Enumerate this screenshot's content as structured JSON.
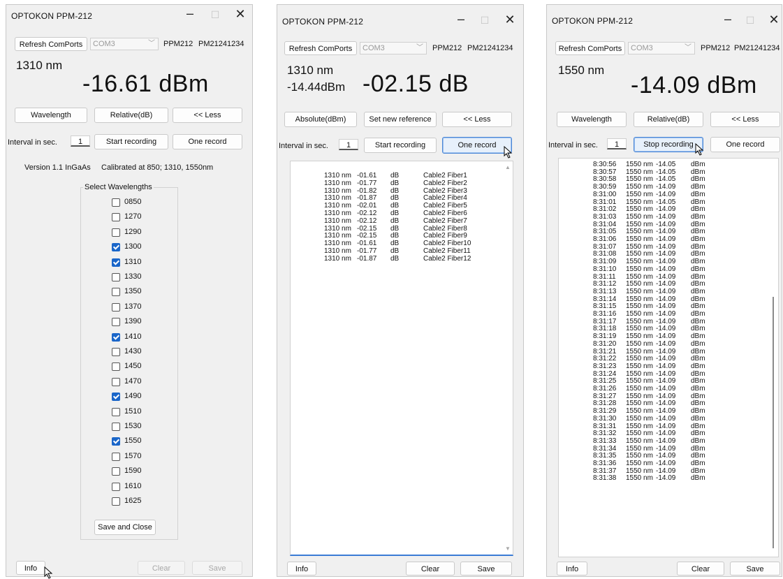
{
  "windows": [
    {
      "title": "OPTOKON  PPM-212",
      "refresh_label": "Refresh ComPorts",
      "com_value": "COM3",
      "device": "PPM212",
      "serial": "PM21241234",
      "wavelength": "1310 nm",
      "reading": "-16.61  dBm",
      "btn_wavelength": "Wavelength",
      "btn_relative": "Relative(dB)",
      "btn_less": "<< Less",
      "interval_label": "Interval in sec.",
      "interval_value": "1",
      "btn_start": "Start recording",
      "btn_one": "One record",
      "version": "Version 1.1  InGaAs",
      "calibrated": "Calibrated at 850; 1310, 1550nm",
      "group_label": "Select Wavelengths",
      "wavelengths": [
        {
          "label": "0850",
          "checked": false
        },
        {
          "label": "1270",
          "checked": false
        },
        {
          "label": "1290",
          "checked": false
        },
        {
          "label": "1300",
          "checked": true
        },
        {
          "label": "1310",
          "checked": true
        },
        {
          "label": "1330",
          "checked": false
        },
        {
          "label": "1350",
          "checked": false
        },
        {
          "label": "1370",
          "checked": false
        },
        {
          "label": "1390",
          "checked": false
        },
        {
          "label": "1410",
          "checked": true
        },
        {
          "label": "1430",
          "checked": false
        },
        {
          "label": "1450",
          "checked": false
        },
        {
          "label": "1470",
          "checked": false
        },
        {
          "label": "1490",
          "checked": true
        },
        {
          "label": "1510",
          "checked": false
        },
        {
          "label": "1530",
          "checked": false
        },
        {
          "label": "1550",
          "checked": true
        },
        {
          "label": "1570",
          "checked": false
        },
        {
          "label": "1590",
          "checked": false
        },
        {
          "label": "1610",
          "checked": false
        },
        {
          "label": "1625",
          "checked": false
        }
      ],
      "btn_save_close": "Save and Close",
      "btn_info": "Info",
      "btn_clear": "Clear",
      "btn_save": "Save"
    },
    {
      "title": "OPTOKON  PPM-212",
      "refresh_label": "Refresh ComPorts",
      "com_value": "COM3",
      "device": "PPM212",
      "serial": "PM21241234",
      "wavelength": "1310 nm",
      "abs_reading": "-14.44dBm",
      "reading": "-02.15  dB",
      "btn_absolute": "Absolute(dBm)",
      "btn_setref": "Set new reference",
      "btn_less": "<< Less",
      "interval_label": "Interval in sec.",
      "interval_value": "1",
      "btn_start": "Start recording",
      "btn_one": "One record",
      "records": [
        {
          "wl": "1310 nm",
          "val": "-01.61",
          "unit": "dB",
          "note": "Cable2 Fiber1"
        },
        {
          "wl": "1310 nm",
          "val": "-01.77",
          "unit": "dB",
          "note": "Cable2 Fiber2"
        },
        {
          "wl": "1310 nm",
          "val": "-01.82",
          "unit": "dB",
          "note": "Cable2 Fiber3"
        },
        {
          "wl": "1310 nm",
          "val": "-01.87",
          "unit": "dB",
          "note": "Cable2 Fiber4"
        },
        {
          "wl": "1310 nm",
          "val": "-02.01",
          "unit": "dB",
          "note": "Cable2 Fiber5"
        },
        {
          "wl": "1310 nm",
          "val": "-02.12",
          "unit": "dB",
          "note": "Cable2 Fiber6"
        },
        {
          "wl": "1310 nm",
          "val": "-02.12",
          "unit": "dB",
          "note": "Cable2 Fiber7"
        },
        {
          "wl": "1310 nm",
          "val": "-02.15",
          "unit": "dB",
          "note": "Cable2 Fiber8"
        },
        {
          "wl": "1310 nm",
          "val": "-02.15",
          "unit": "dB",
          "note": "Cable2 Fiber9"
        },
        {
          "wl": "1310 nm",
          "val": "-01.61",
          "unit": "dB",
          "note": "Cable2 Fiber10"
        },
        {
          "wl": "1310 nm",
          "val": "-01.77",
          "unit": "dB",
          "note": "Cable2 Fiber11"
        },
        {
          "wl": "1310 nm",
          "val": "-01.87",
          "unit": "dB",
          "note": "Cable2 Fiber12"
        }
      ],
      "btn_info": "Info",
      "btn_clear": "Clear",
      "btn_save": "Save"
    },
    {
      "title": "OPTOKON  PPM-212",
      "refresh_label": "Refresh ComPorts",
      "com_value": "COM3",
      "device": "PPM212",
      "serial": "PM21241234",
      "wavelength": "1550 nm",
      "reading": "-14.09  dBm",
      "btn_wavelength": "Wavelength",
      "btn_relative": "Relative(dB)",
      "btn_less": "<< Less",
      "interval_label": "Interval in sec.",
      "interval_value": "1",
      "btn_stop": "Stop recording",
      "btn_one": "One record",
      "log": [
        {
          "t": "8:30:56",
          "wl": "1550 nm",
          "v": "-14.05",
          "u": "dBm"
        },
        {
          "t": "8:30:57",
          "wl": "1550 nm",
          "v": "-14.05",
          "u": "dBm"
        },
        {
          "t": "8:30:58",
          "wl": "1550 nm",
          "v": "-14.05",
          "u": "dBm"
        },
        {
          "t": "8:30:59",
          "wl": "1550 nm",
          "v": "-14.09",
          "u": "dBm"
        },
        {
          "t": "8:31:00",
          "wl": "1550 nm",
          "v": "-14.09",
          "u": "dBm"
        },
        {
          "t": "8:31:01",
          "wl": "1550 nm",
          "v": "-14.05",
          "u": "dBm"
        },
        {
          "t": "8:31:02",
          "wl": "1550 nm",
          "v": "-14.09",
          "u": "dBm"
        },
        {
          "t": "8:31:03",
          "wl": "1550 nm",
          "v": "-14.09",
          "u": "dBm"
        },
        {
          "t": "8:31:04",
          "wl": "1550 nm",
          "v": "-14.09",
          "u": "dBm"
        },
        {
          "t": "8:31:05",
          "wl": "1550 nm",
          "v": "-14.09",
          "u": "dBm"
        },
        {
          "t": "8:31:06",
          "wl": "1550 nm",
          "v": "-14.09",
          "u": "dBm"
        },
        {
          "t": "8:31:07",
          "wl": "1550 nm",
          "v": "-14.09",
          "u": "dBm"
        },
        {
          "t": "8:31:08",
          "wl": "1550 nm",
          "v": "-14.09",
          "u": "dBm"
        },
        {
          "t": "8:31:09",
          "wl": "1550 nm",
          "v": "-14.09",
          "u": "dBm"
        },
        {
          "t": "8:31:10",
          "wl": "1550 nm",
          "v": "-14.09",
          "u": "dBm"
        },
        {
          "t": "8:31:11",
          "wl": "1550 nm",
          "v": "-14.09",
          "u": "dBm"
        },
        {
          "t": "8:31:12",
          "wl": "1550 nm",
          "v": "-14.09",
          "u": "dBm"
        },
        {
          "t": "8:31:13",
          "wl": "1550 nm",
          "v": "-14.09",
          "u": "dBm"
        },
        {
          "t": "8:31:14",
          "wl": "1550 nm",
          "v": "-14.09",
          "u": "dBm"
        },
        {
          "t": "8:31:15",
          "wl": "1550 nm",
          "v": "-14.09",
          "u": "dBm"
        },
        {
          "t": "8:31:16",
          "wl": "1550 nm",
          "v": "-14.09",
          "u": "dBm"
        },
        {
          "t": "8:31:17",
          "wl": "1550 nm",
          "v": "-14.09",
          "u": "dBm"
        },
        {
          "t": "8:31:18",
          "wl": "1550 nm",
          "v": "-14.09",
          "u": "dBm"
        },
        {
          "t": "8:31:19",
          "wl": "1550 nm",
          "v": "-14.09",
          "u": "dBm"
        },
        {
          "t": "8:31:20",
          "wl": "1550 nm",
          "v": "-14.09",
          "u": "dBm"
        },
        {
          "t": "8:31:21",
          "wl": "1550 nm",
          "v": "-14.09",
          "u": "dBm"
        },
        {
          "t": "8:31:22",
          "wl": "1550 nm",
          "v": "-14.09",
          "u": "dBm"
        },
        {
          "t": "8:31:23",
          "wl": "1550 nm",
          "v": "-14.09",
          "u": "dBm"
        },
        {
          "t": "8:31:24",
          "wl": "1550 nm",
          "v": "-14.09",
          "u": "dBm"
        },
        {
          "t": "8:31:25",
          "wl": "1550 nm",
          "v": "-14.09",
          "u": "dBm"
        },
        {
          "t": "8:31:26",
          "wl": "1550 nm",
          "v": "-14.09",
          "u": "dBm"
        },
        {
          "t": "8:31:27",
          "wl": "1550 nm",
          "v": "-14.09",
          "u": "dBm"
        },
        {
          "t": "8:31:28",
          "wl": "1550 nm",
          "v": "-14.09",
          "u": "dBm"
        },
        {
          "t": "8:31:29",
          "wl": "1550 nm",
          "v": "-14.09",
          "u": "dBm"
        },
        {
          "t": "8:31:30",
          "wl": "1550 nm",
          "v": "-14.09",
          "u": "dBm"
        },
        {
          "t": "8:31:31",
          "wl": "1550 nm",
          "v": "-14.09",
          "u": "dBm"
        },
        {
          "t": "8:31:32",
          "wl": "1550 nm",
          "v": "-14.09",
          "u": "dBm"
        },
        {
          "t": "8:31:33",
          "wl": "1550 nm",
          "v": "-14.09",
          "u": "dBm"
        },
        {
          "t": "8:31:34",
          "wl": "1550 nm",
          "v": "-14.09",
          "u": "dBm"
        },
        {
          "t": "8:31:35",
          "wl": "1550 nm",
          "v": "-14.09",
          "u": "dBm"
        },
        {
          "t": "8:31:36",
          "wl": "1550 nm",
          "v": "-14.09",
          "u": "dBm"
        },
        {
          "t": "8:31:37",
          "wl": "1550 nm",
          "v": "-14.09",
          "u": "dBm"
        },
        {
          "t": "8:31:38",
          "wl": "1550 nm",
          "v": "-14.09",
          "u": "dBm"
        }
      ],
      "btn_info": "Info",
      "btn_clear": "Clear",
      "btn_save": "Save"
    }
  ],
  "icons": {
    "minimize": "minimize-icon",
    "maximize": "maximize-icon",
    "close": "close-icon",
    "dropdown": "chevron-down-icon",
    "cursor": "mouse-pointer-icon"
  },
  "colors": {
    "checkbox_checked": "#1a66c9",
    "focus_border": "#4a86d6",
    "window_bg": "#f0f0f0"
  }
}
